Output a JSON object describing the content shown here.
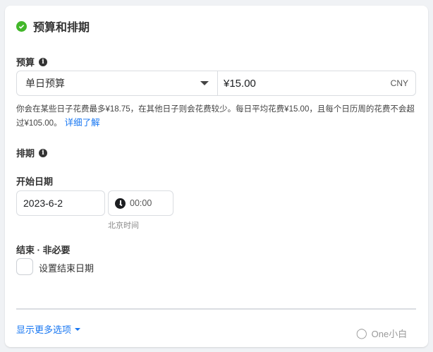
{
  "section": {
    "title": "预算和排期"
  },
  "budget": {
    "label": "预算",
    "type_selected": "单日预算",
    "amount": "¥15.00",
    "currency": "CNY",
    "help_text": "你会在某些日子花费最多¥18.75，在其他日子则会花费较少。每日平均花费¥15.00，且每个日历周的花费不会超过¥105.00。",
    "learn_more": "详细了解"
  },
  "schedule": {
    "label": "排期",
    "start_label": "开始日期",
    "start_date": "2023-6-2",
    "start_time": "00:00",
    "timezone": "北京时间",
    "end_label": "结束 · 非必要",
    "end_checkbox_label": "设置结束日期",
    "end_checked": false
  },
  "footer": {
    "more_options": "显示更多选项",
    "watermark": "One小白"
  }
}
